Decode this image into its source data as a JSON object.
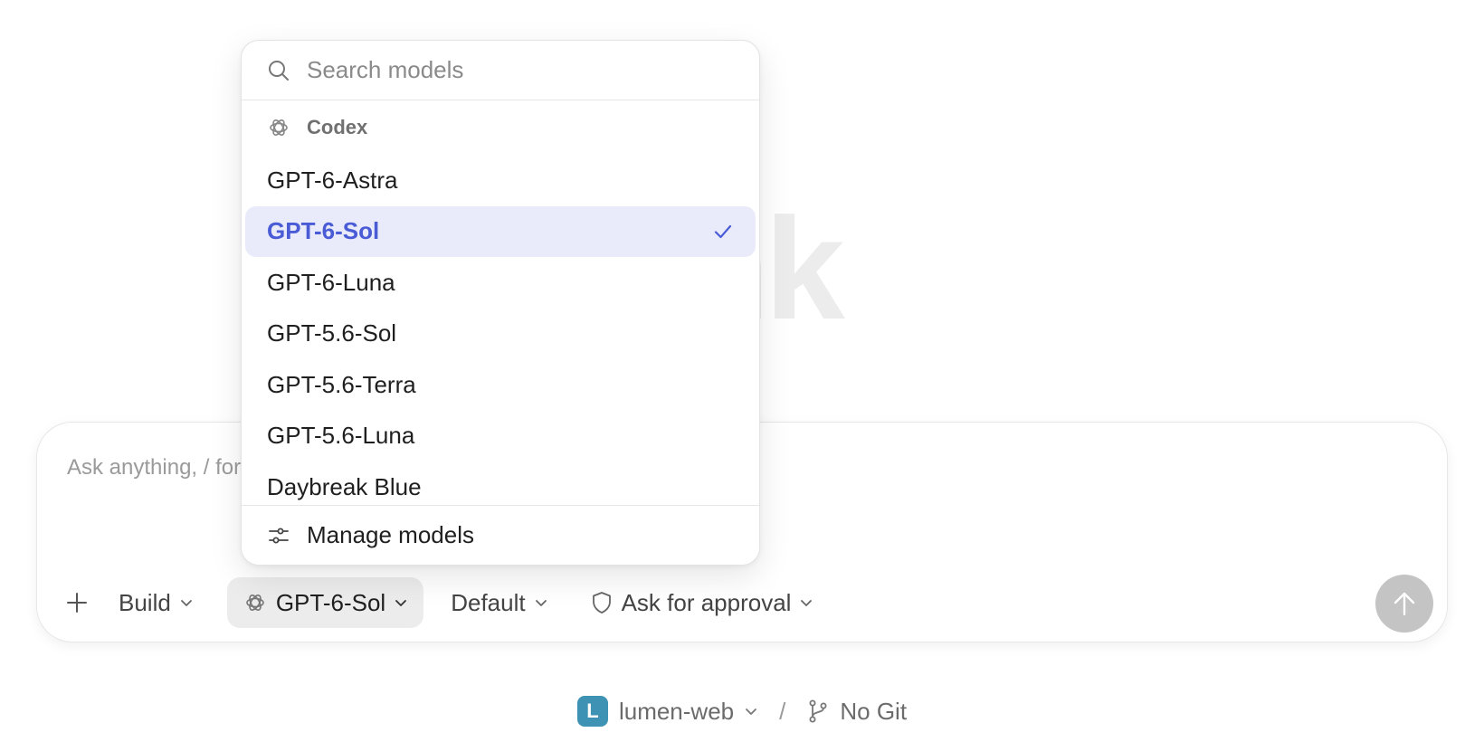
{
  "background": {
    "wordmark": "delnk"
  },
  "composer": {
    "placeholder": "Ask anything, / for commands, @ for files",
    "toolbar": {
      "mode_label": "Build",
      "model_label": "GPT-6-Sol",
      "profile_label": "Default",
      "approval_label": "Ask for approval"
    }
  },
  "footer": {
    "project_initial": "L",
    "project_name": "lumen-web",
    "separator": "/",
    "git_label": "No Git"
  },
  "model_dropdown": {
    "search_placeholder": "Search models",
    "group_label": "Codex",
    "items": [
      {
        "label": "GPT-6-Astra",
        "selected": false
      },
      {
        "label": "GPT-6-Sol",
        "selected": true
      },
      {
        "label": "GPT-6-Luna",
        "selected": false
      },
      {
        "label": "GPT-5.6-Sol",
        "selected": false
      },
      {
        "label": "GPT-5.6-Terra",
        "selected": false
      },
      {
        "label": "GPT-5.6-Luna",
        "selected": false
      },
      {
        "label": "Daybreak Blue",
        "selected": false
      }
    ],
    "manage_label": "Manage models"
  },
  "colors": {
    "accent": "#4a5bd6",
    "selected_bg": "#e9ebfb",
    "project_avatar": "#3e93b4",
    "send_button": "#c4c4c4"
  },
  "icons": {
    "search": "search-icon",
    "group": "openai-logo-icon",
    "check": "check-icon",
    "manage": "sliders-icon",
    "plus": "plus-icon",
    "approval": "shield-icon",
    "send": "arrow-up-icon",
    "git": "git-branch-icon"
  }
}
